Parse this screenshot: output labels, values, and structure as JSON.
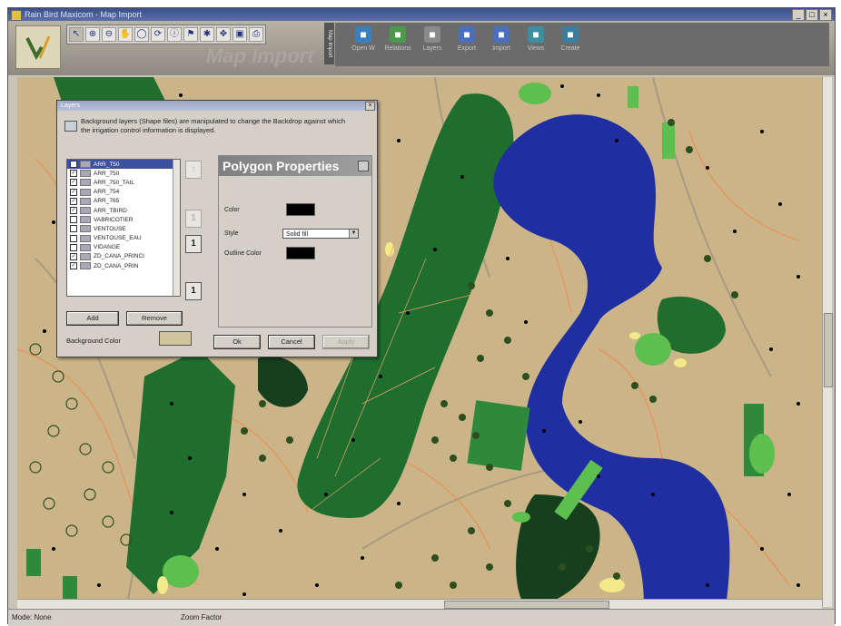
{
  "window": {
    "title": "Rain Bird Maxicom - Map Import",
    "controls": [
      "_",
      "□",
      "×"
    ]
  },
  "toolbar": {
    "tools": [
      "pointer-icon",
      "zoom-in-icon",
      "zoom-out-icon",
      "pan-icon",
      "rotate-icon",
      "refresh-icon",
      "info-icon",
      "flag-icon",
      "snap-icon",
      "move-icon",
      "select-icon",
      "print-icon"
    ],
    "tool_glyphs": [
      "↖",
      "⊕",
      "⊖",
      "✋",
      "◯",
      "⟳",
      "ⓘ",
      "⚑",
      "✱",
      "✥",
      "▣",
      "⎙"
    ],
    "mode_title": "Map Import"
  },
  "mode_buttons": [
    {
      "label": "Open W",
      "icon": "open-icon",
      "color": "#3a7fc0"
    },
    {
      "label": "Relations",
      "icon": "grid-icon",
      "color": "#4a9a4a"
    },
    {
      "label": "Layers",
      "icon": "layers-icon",
      "color": "#8a8a8a"
    },
    {
      "label": "Export",
      "icon": "export-icon",
      "color": "#4a6fc0"
    },
    {
      "label": "Import",
      "icon": "import-icon",
      "color": "#4a6fc0"
    },
    {
      "label": "Views",
      "icon": "views-icon",
      "color": "#3a8fa0"
    },
    {
      "label": "Create",
      "icon": "create-icon",
      "color": "#3a7fa0"
    }
  ],
  "dialog": {
    "title": "Layers",
    "info": "Background layers (Shape files) are manipulated to change the Backdrop against which the irrigation control information is displayed.",
    "layers": [
      {
        "name": "ARR_T50",
        "checked": true
      },
      {
        "name": "ARR_750",
        "checked": true
      },
      {
        "name": "ARR_750_TAIL",
        "checked": true
      },
      {
        "name": "ARR_754",
        "checked": true
      },
      {
        "name": "ARR_765",
        "checked": true
      },
      {
        "name": "ARR_TBIRD",
        "checked": true
      },
      {
        "name": "VABRICOTIER",
        "checked": false
      },
      {
        "name": "VENTOUSE",
        "checked": false
      },
      {
        "name": "VENTOUSE_EAU",
        "checked": false
      },
      {
        "name": "VIDANGE",
        "checked": false
      },
      {
        "name": "ZD_CANA_PRINCI",
        "checked": true
      },
      {
        "name": "ZD_CANA_PRIN",
        "checked": true
      }
    ],
    "add_label": "Add",
    "remove_label": "Remove",
    "background_color_label": "Background Color",
    "order_buttons": [
      "↑",
      "1",
      "1",
      "1"
    ],
    "ok_label": "Ok",
    "cancel_label": "Cancel",
    "apply_label": "Apply",
    "polygon_properties": {
      "title": "Polygon Properties",
      "color_label": "Color",
      "style_label": "Style",
      "style_value": "Solid fill",
      "outline_color_label": "Outline Color"
    }
  },
  "statusbar": {
    "mode": "Mode: None",
    "zoom": "Zoom Factor"
  },
  "colors": {
    "map_ground": "#cbb488",
    "water": "#1f2ea0",
    "fairway": "#1f6e2e",
    "green": "#5cbf4e",
    "bunker": "#f3e88a",
    "tree": "#2d4f1f",
    "path": "#f08a50"
  }
}
